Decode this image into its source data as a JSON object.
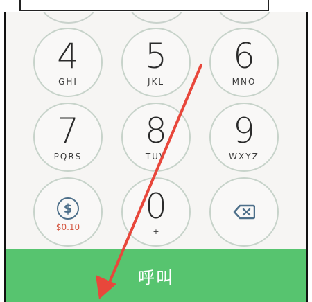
{
  "keypad": {
    "row2": [
      {
        "digit": "4",
        "letters": "GHI"
      },
      {
        "digit": "5",
        "letters": "JKL"
      },
      {
        "digit": "6",
        "letters": "MNO"
      }
    ],
    "row3": [
      {
        "digit": "7",
        "letters": "PQRS"
      },
      {
        "digit": "8",
        "letters": "TUV"
      },
      {
        "digit": "9",
        "letters": "WXYZ"
      }
    ],
    "row4": {
      "credit_symbol": "$",
      "credit_amount": "$0.10",
      "zero_digit": "0",
      "zero_sub": "+"
    }
  },
  "call_button": {
    "label": "呼叫"
  },
  "colors": {
    "call_green": "#57c46f",
    "arrow_red": "#e8473b",
    "ring": "#c7d3ca",
    "credit_blue": "#4d6f8a",
    "credit_red": "#d4553f"
  },
  "icons": {
    "delete": "backspace-icon",
    "credit": "dollar-coin-icon",
    "annotation": "red-arrow-icon"
  }
}
